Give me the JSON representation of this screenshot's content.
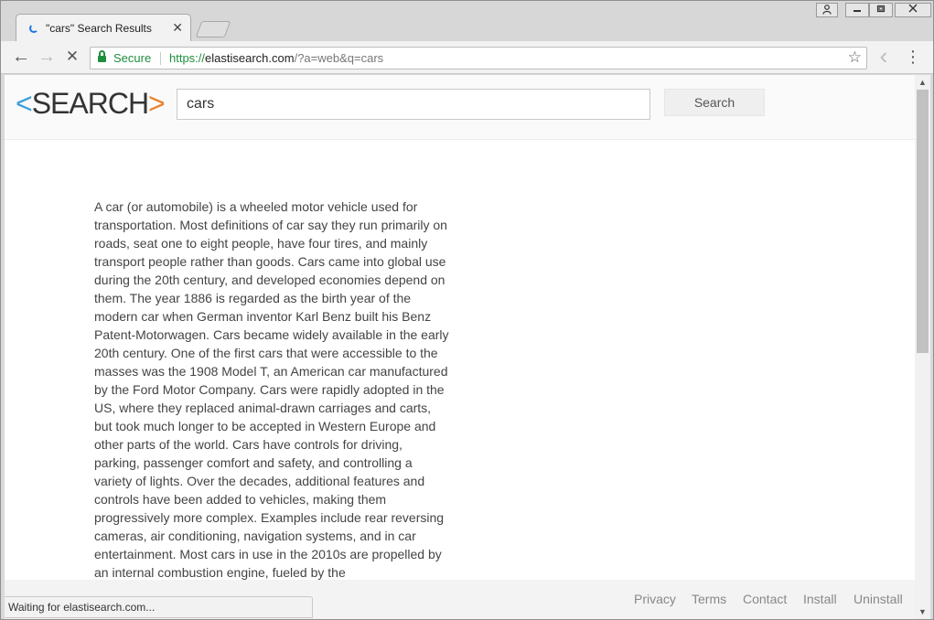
{
  "browser": {
    "tab_title": "\"cars\" Search Results",
    "tab_close": "✕",
    "url_scheme": "https://",
    "url_host": "elastisearch.com",
    "url_path": "/?a=web&q=cars",
    "secure_label": "Secure",
    "status_text": "Waiting for elastisearch.com..."
  },
  "header": {
    "logo_lt": "<",
    "logo_word": "SEARCH",
    "logo_gt": ">",
    "search_value": "cars",
    "search_button": "Search"
  },
  "result": {
    "text": "A car (or automobile) is a wheeled motor vehicle used for transportation. Most definitions of car say they run primarily on roads, seat one to eight people, have four tires, and mainly transport people rather than goods. Cars came into global use during the 20th century, and developed economies depend on them. The year 1886 is regarded as the birth year of the modern car when German inventor Karl Benz built his Benz Patent-Motorwagen. Cars became widely available in the early 20th century. One of the first cars that were accessible to the masses was the 1908 Model T, an American car manufactured by the Ford Motor Company. Cars were rapidly adopted in the US, where they replaced animal-drawn carriages and carts, but took much longer to be accepted in Western Europe and other parts of the world. Cars have controls for driving, parking, passenger comfort and safety, and controlling a variety of lights. Over the decades, additional features and controls have been added to vehicles, making them progressively more complex. Examples include rear reversing cameras, air conditioning, navigation systems, and in car entertainment. Most cars in use in the 2010s are propelled by an internal combustion engine, fueled by the"
  },
  "footer": {
    "privacy": "Privacy",
    "terms": "Terms",
    "contact": "Contact",
    "install": "Install",
    "uninstall": "Uninstall"
  },
  "icons": {
    "back": "←",
    "forward": "→",
    "stop": "✕",
    "star": "☆",
    "menu": "⋮",
    "ext_back": "‹"
  }
}
